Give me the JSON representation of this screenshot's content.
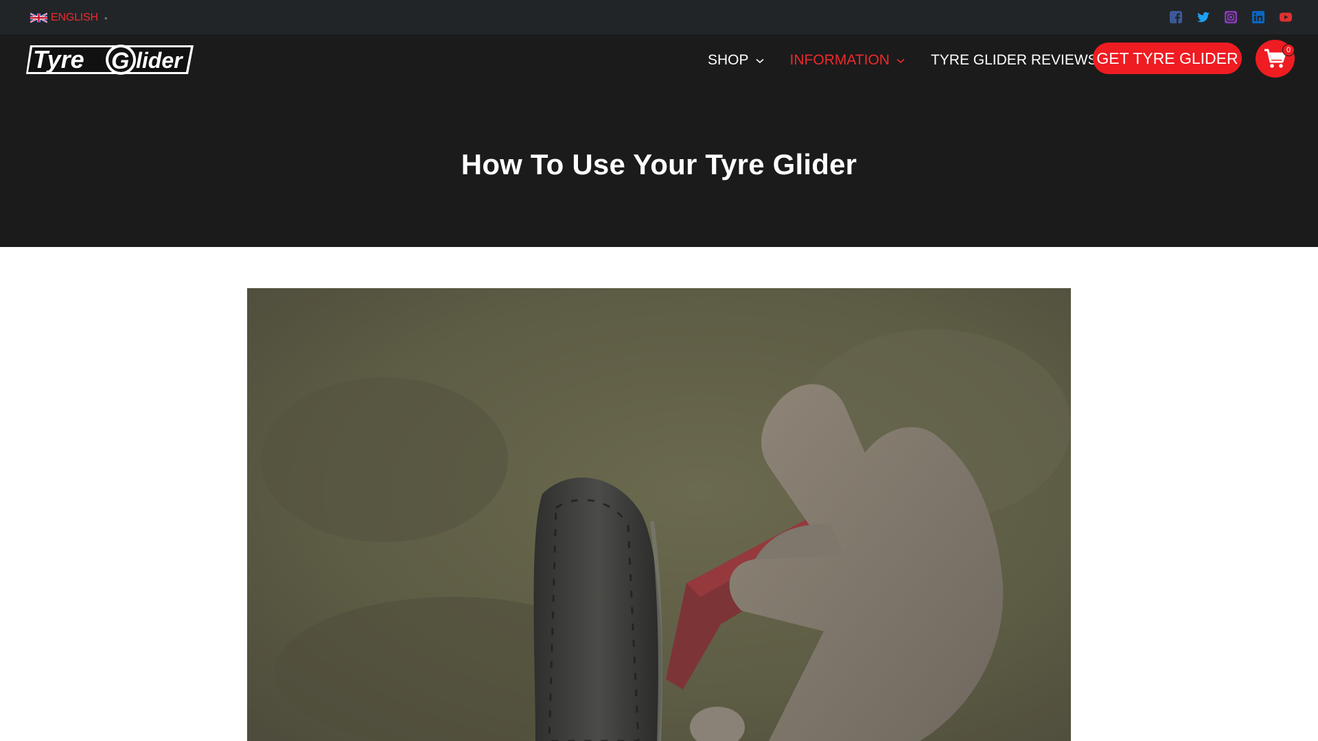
{
  "topbar": {
    "language": {
      "label": "ENGLISH",
      "flag_icon": "uk-flag-icon"
    },
    "socials": [
      {
        "icon": "facebook-icon",
        "color": "#3b5998"
      },
      {
        "icon": "twitter-icon",
        "color": "#1da1f2"
      },
      {
        "icon": "instagram-icon",
        "color": "#8a3ab9"
      },
      {
        "icon": "linkedin-icon",
        "color": "#0a66c2"
      },
      {
        "icon": "youtube-icon",
        "color": "#e0312f"
      }
    ]
  },
  "header": {
    "logo_text": "Tyre Glider",
    "nav": [
      {
        "label": "SHOP",
        "has_dropdown": true,
        "active": false
      },
      {
        "label": "INFORMATION",
        "has_dropdown": true,
        "active": true
      },
      {
        "label": "TYRE GLIDER REVIEWS",
        "has_dropdown": false,
        "active": false
      }
    ],
    "cta_label": "GET TYRE GLIDER",
    "cart_count": "0"
  },
  "page": {
    "title": "How To Use Your Tyre Glider"
  },
  "colors": {
    "accent": "#ef1c22",
    "topbar_bg": "#222528",
    "header_bg": "#1b1b1b"
  }
}
